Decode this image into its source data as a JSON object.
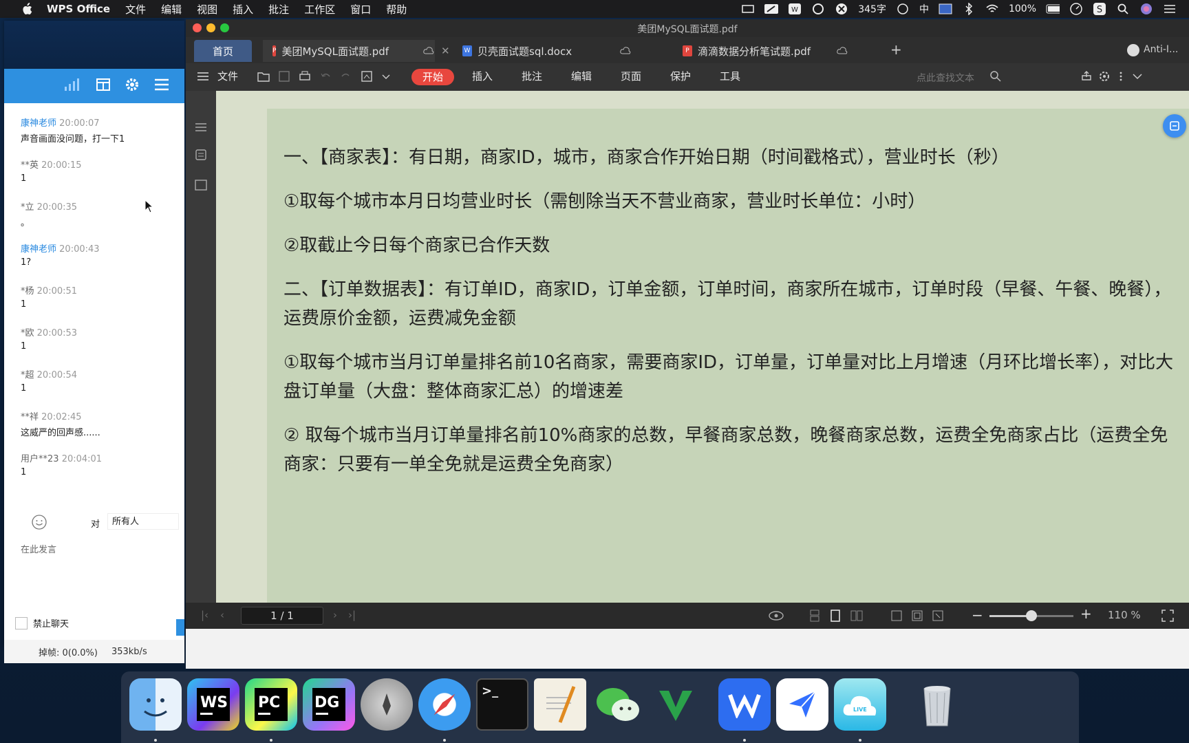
{
  "menubar": {
    "app": "WPS Office",
    "items": [
      "文件",
      "编辑",
      "视图",
      "插入",
      "批注",
      "工作区",
      "窗口",
      "帮助"
    ],
    "status_words": "345字",
    "input_method": "中",
    "battery": "100%"
  },
  "chat": {
    "messages": [
      {
        "name": "康神老师",
        "time": "20:00:07",
        "text": "声音画面没问题，打一下1",
        "teacher": true
      },
      {
        "name": "**英",
        "time": "20:00:15",
        "text": "1",
        "teacher": false
      },
      {
        "name": "*立",
        "time": "20:00:35",
        "text": "。",
        "teacher": false
      },
      {
        "name": "康神老师",
        "time": "20:00:43",
        "text": "1?",
        "teacher": true
      },
      {
        "name": "*杨",
        "time": "20:00:51",
        "text": "1",
        "teacher": false
      },
      {
        "name": "*欧",
        "time": "20:00:53",
        "text": "1",
        "teacher": false
      },
      {
        "name": "*超",
        "time": "20:00:54",
        "text": "1",
        "teacher": false
      },
      {
        "name": "**祥",
        "time": "20:02:45",
        "text": "这威严的回声感......",
        "teacher": false
      },
      {
        "name": "用户**23",
        "time": "20:04:01",
        "text": "1",
        "teacher": false
      }
    ],
    "to_label": "对",
    "to_value": "所有人",
    "input_placeholder": "在此发言",
    "ban_label": "禁止聊天",
    "drop_frames": "掉帧: 0(0.0%)",
    "bandwidth": "353kb/s"
  },
  "wps": {
    "window_title": "美团MySQL面试题.pdf",
    "tabs": [
      {
        "label": "首页"
      },
      {
        "label": "美团MySQL面试题.pdf"
      },
      {
        "label": "贝壳面试题sql.docx"
      },
      {
        "label": "滴滴数据分析笔试题.pdf"
      }
    ],
    "account": "Anti-I...",
    "toolbar": {
      "file": "文件",
      "start": "开始",
      "insert": "插入",
      "annotate": "批注",
      "edit": "编辑",
      "page": "页面",
      "protect": "保护",
      "tools": "工具",
      "search_placeholder": "点此查找文本"
    },
    "document": {
      "paragraphs": [
        "一、【商家表】：有日期，商家ID，城市，商家合作开始日期（时间戳格式），营业时长（秒）",
        "①取每个城市本月日均营业时长（需刨除当天不营业商家，营业时长单位：小时）",
        "②取截止今日每个商家已合作天数",
        "二、【订单数据表】：有订单ID，商家ID，订单金额，订单时间，商家所在城市，订单时段（早餐、午餐、晚餐），运费原价金额，运费减免金额",
        "①取每个城市当月订单量排名前10名商家，需要商家ID，订单量，订单量对比上月增速（月环比增长率），对比大盘订单量（大盘：整体商家汇总）的增速差",
        "② 取每个城市当月订单量排名前10%商家的总数，早餐商家总数，晚餐商家总数，运费全免商家占比（运费全免商家：只要有一单全免就是运费全免商家）"
      ]
    },
    "status": {
      "page": "1 / 1",
      "zoom": "110 %",
      "zoom_level": 0.5
    }
  },
  "dock": {
    "apps": [
      "finder",
      "webstorm",
      "pycharm",
      "datagrip",
      "launchpad",
      "safari",
      "terminal",
      "textedit",
      "wechat",
      "vim",
      "wps",
      "feishu",
      "cloud-live",
      "trash"
    ]
  }
}
